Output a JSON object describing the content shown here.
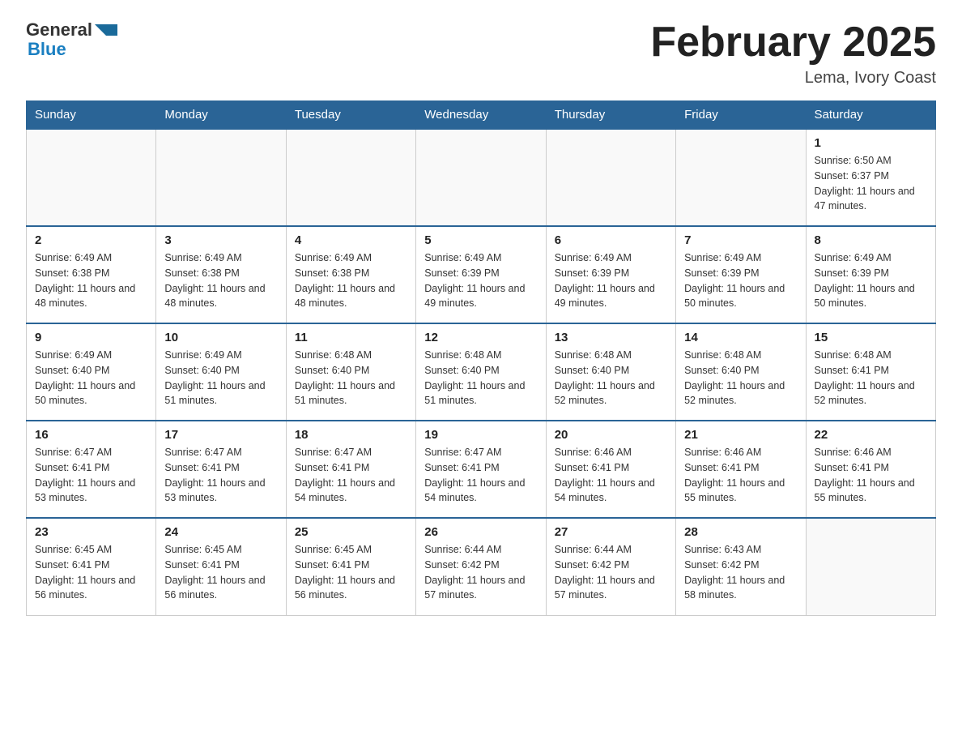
{
  "header": {
    "logo_general": "General",
    "logo_blue": "Blue",
    "title": "February 2025",
    "location": "Lema, Ivory Coast"
  },
  "days_of_week": [
    "Sunday",
    "Monday",
    "Tuesday",
    "Wednesday",
    "Thursday",
    "Friday",
    "Saturday"
  ],
  "weeks": [
    {
      "days": [
        {
          "number": "",
          "info": ""
        },
        {
          "number": "",
          "info": ""
        },
        {
          "number": "",
          "info": ""
        },
        {
          "number": "",
          "info": ""
        },
        {
          "number": "",
          "info": ""
        },
        {
          "number": "",
          "info": ""
        },
        {
          "number": "1",
          "info": "Sunrise: 6:50 AM\nSunset: 6:37 PM\nDaylight: 11 hours and 47 minutes."
        }
      ]
    },
    {
      "days": [
        {
          "number": "2",
          "info": "Sunrise: 6:49 AM\nSunset: 6:38 PM\nDaylight: 11 hours and 48 minutes."
        },
        {
          "number": "3",
          "info": "Sunrise: 6:49 AM\nSunset: 6:38 PM\nDaylight: 11 hours and 48 minutes."
        },
        {
          "number": "4",
          "info": "Sunrise: 6:49 AM\nSunset: 6:38 PM\nDaylight: 11 hours and 48 minutes."
        },
        {
          "number": "5",
          "info": "Sunrise: 6:49 AM\nSunset: 6:39 PM\nDaylight: 11 hours and 49 minutes."
        },
        {
          "number": "6",
          "info": "Sunrise: 6:49 AM\nSunset: 6:39 PM\nDaylight: 11 hours and 49 minutes."
        },
        {
          "number": "7",
          "info": "Sunrise: 6:49 AM\nSunset: 6:39 PM\nDaylight: 11 hours and 50 minutes."
        },
        {
          "number": "8",
          "info": "Sunrise: 6:49 AM\nSunset: 6:39 PM\nDaylight: 11 hours and 50 minutes."
        }
      ]
    },
    {
      "days": [
        {
          "number": "9",
          "info": "Sunrise: 6:49 AM\nSunset: 6:40 PM\nDaylight: 11 hours and 50 minutes."
        },
        {
          "number": "10",
          "info": "Sunrise: 6:49 AM\nSunset: 6:40 PM\nDaylight: 11 hours and 51 minutes."
        },
        {
          "number": "11",
          "info": "Sunrise: 6:48 AM\nSunset: 6:40 PM\nDaylight: 11 hours and 51 minutes."
        },
        {
          "number": "12",
          "info": "Sunrise: 6:48 AM\nSunset: 6:40 PM\nDaylight: 11 hours and 51 minutes."
        },
        {
          "number": "13",
          "info": "Sunrise: 6:48 AM\nSunset: 6:40 PM\nDaylight: 11 hours and 52 minutes."
        },
        {
          "number": "14",
          "info": "Sunrise: 6:48 AM\nSunset: 6:40 PM\nDaylight: 11 hours and 52 minutes."
        },
        {
          "number": "15",
          "info": "Sunrise: 6:48 AM\nSunset: 6:41 PM\nDaylight: 11 hours and 52 minutes."
        }
      ]
    },
    {
      "days": [
        {
          "number": "16",
          "info": "Sunrise: 6:47 AM\nSunset: 6:41 PM\nDaylight: 11 hours and 53 minutes."
        },
        {
          "number": "17",
          "info": "Sunrise: 6:47 AM\nSunset: 6:41 PM\nDaylight: 11 hours and 53 minutes."
        },
        {
          "number": "18",
          "info": "Sunrise: 6:47 AM\nSunset: 6:41 PM\nDaylight: 11 hours and 54 minutes."
        },
        {
          "number": "19",
          "info": "Sunrise: 6:47 AM\nSunset: 6:41 PM\nDaylight: 11 hours and 54 minutes."
        },
        {
          "number": "20",
          "info": "Sunrise: 6:46 AM\nSunset: 6:41 PM\nDaylight: 11 hours and 54 minutes."
        },
        {
          "number": "21",
          "info": "Sunrise: 6:46 AM\nSunset: 6:41 PM\nDaylight: 11 hours and 55 minutes."
        },
        {
          "number": "22",
          "info": "Sunrise: 6:46 AM\nSunset: 6:41 PM\nDaylight: 11 hours and 55 minutes."
        }
      ]
    },
    {
      "days": [
        {
          "number": "23",
          "info": "Sunrise: 6:45 AM\nSunset: 6:41 PM\nDaylight: 11 hours and 56 minutes."
        },
        {
          "number": "24",
          "info": "Sunrise: 6:45 AM\nSunset: 6:41 PM\nDaylight: 11 hours and 56 minutes."
        },
        {
          "number": "25",
          "info": "Sunrise: 6:45 AM\nSunset: 6:41 PM\nDaylight: 11 hours and 56 minutes."
        },
        {
          "number": "26",
          "info": "Sunrise: 6:44 AM\nSunset: 6:42 PM\nDaylight: 11 hours and 57 minutes."
        },
        {
          "number": "27",
          "info": "Sunrise: 6:44 AM\nSunset: 6:42 PM\nDaylight: 11 hours and 57 minutes."
        },
        {
          "number": "28",
          "info": "Sunrise: 6:43 AM\nSunset: 6:42 PM\nDaylight: 11 hours and 58 minutes."
        },
        {
          "number": "",
          "info": ""
        }
      ]
    }
  ]
}
